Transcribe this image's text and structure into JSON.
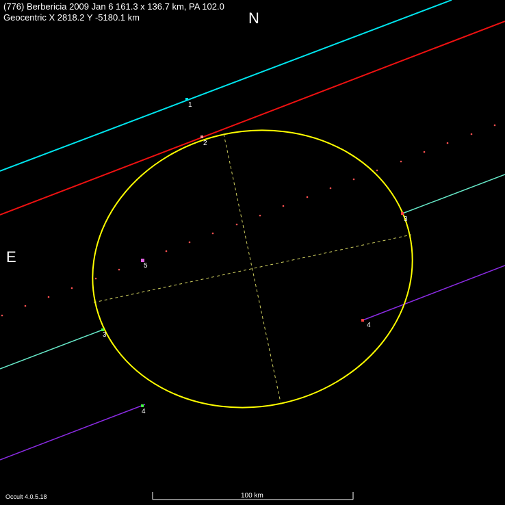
{
  "header": {
    "title": "(776) Berbericia  2009 Jan 6   161.3 x 136.7 km, PA 102.0",
    "geocentric": "Geocentric X  2818.2  Y -5180.1 km"
  },
  "compass": {
    "north": "N",
    "east": "E"
  },
  "footer": {
    "version": "Occult 4.0.5.18",
    "scale_label": "100 km"
  },
  "chords": [
    {
      "id": "1",
      "label": "1",
      "color": "#00e5ee",
      "type": "miss"
    },
    {
      "id": "2",
      "label": "2",
      "color": "#ee1111",
      "type": "miss"
    },
    {
      "id": "3",
      "label": "3",
      "color": "#66e8c8",
      "type": "positive"
    },
    {
      "id": "4",
      "label": "4",
      "color": "#8a2be2",
      "type": "positive"
    },
    {
      "id": "5",
      "label": "5",
      "color": "#e060e0",
      "type": "point"
    }
  ],
  "colors": {
    "background": "#000000",
    "ellipse": "#ffff00",
    "axes": "#d0d060",
    "path_dots": "#ff5050",
    "text": "#ffffff"
  }
}
